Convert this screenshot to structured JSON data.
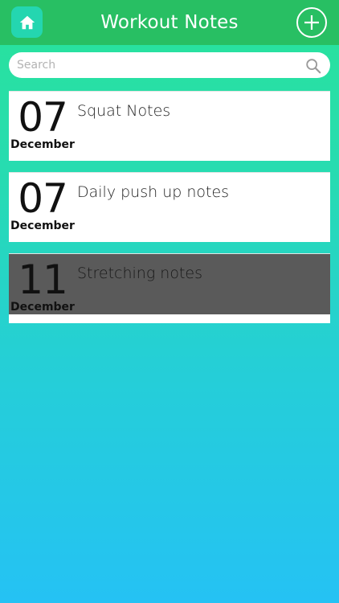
{
  "header": {
    "title": "Workout Notes",
    "home_icon": "home-icon",
    "add_icon": "plus-circle-icon"
  },
  "search": {
    "placeholder": "Search",
    "value": "",
    "icon": "search-icon"
  },
  "notes": [
    {
      "day": "07",
      "month": "December",
      "title": "Squat Notes",
      "selected": false
    },
    {
      "day": "07",
      "month": "December",
      "title": "Daily push up notes",
      "selected": false
    },
    {
      "day": "11",
      "month": "December",
      "title": "Stretching notes",
      "selected": true
    }
  ],
  "colors": {
    "header": "#28bf63",
    "home_button": "#24d6b0",
    "background_top": "#29e39a",
    "background_bottom": "#25c2f4",
    "selected_row": "#5a5a5a"
  }
}
